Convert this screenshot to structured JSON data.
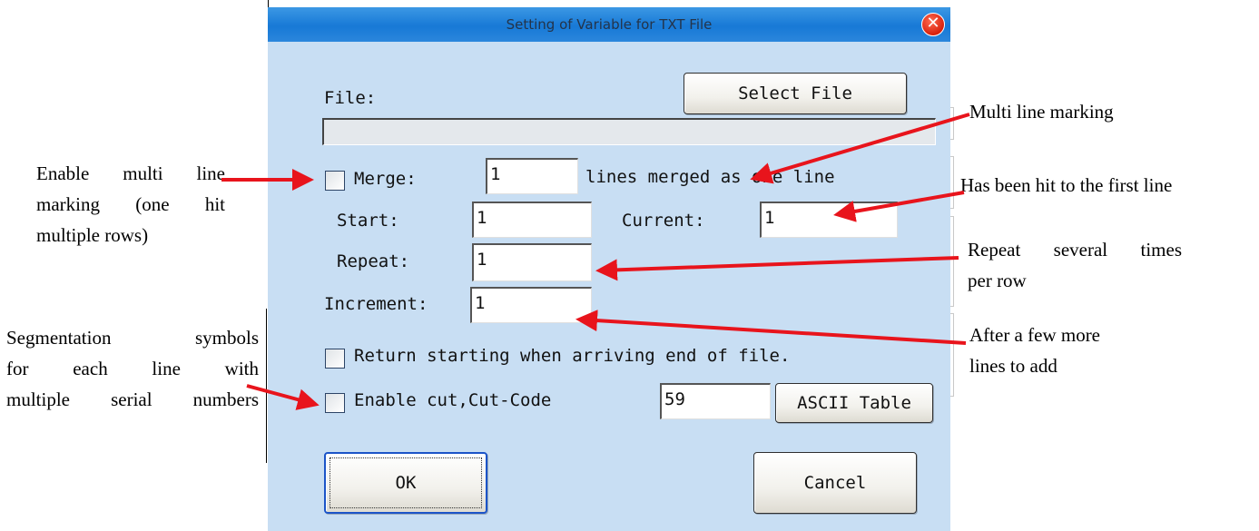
{
  "dialog": {
    "title": "Setting of Variable for TXT File",
    "close_icon": "close-icon",
    "file_label": "File:",
    "select_file_label": "Select File",
    "file_path_value": "",
    "merge_label": "Merge:",
    "merge_value": "1",
    "merge_suffix": "lines merged as one line",
    "start_label": "Start:",
    "start_value": "1",
    "current_label": "Current:",
    "current_value": "1",
    "repeat_label": "Repeat:",
    "repeat_value": "1",
    "increment_label": "Increment:",
    "increment_value": "1",
    "return_label": "Return starting when arriving end of file.",
    "cut_label": "Enable cut,Cut-Code",
    "cut_value": "59",
    "ascii_label": "ASCII Table",
    "ok_label": "OK",
    "cancel_label": "Cancel"
  },
  "annotations": {
    "multi_line_marking": "Multi line marking",
    "first_line": "Has been hit to the first line",
    "repeat_line1": "Repeat several times",
    "repeat_line2": "per row",
    "after_line1": "After a few more",
    "after_line2": "lines to add",
    "enable_line1": "Enable multi line",
    "enable_line2": "marking (one hit",
    "enable_line3": "multiple rows)",
    "seg_line1": "Segmentation symbols",
    "seg_line2": "for each line with",
    "seg_line3": "multiple serial numbers"
  },
  "colors": {
    "dialog_bg": "#c8def3",
    "titlebar": "#1779d6",
    "arrow": "#e8141c",
    "close": "#d8210d"
  }
}
